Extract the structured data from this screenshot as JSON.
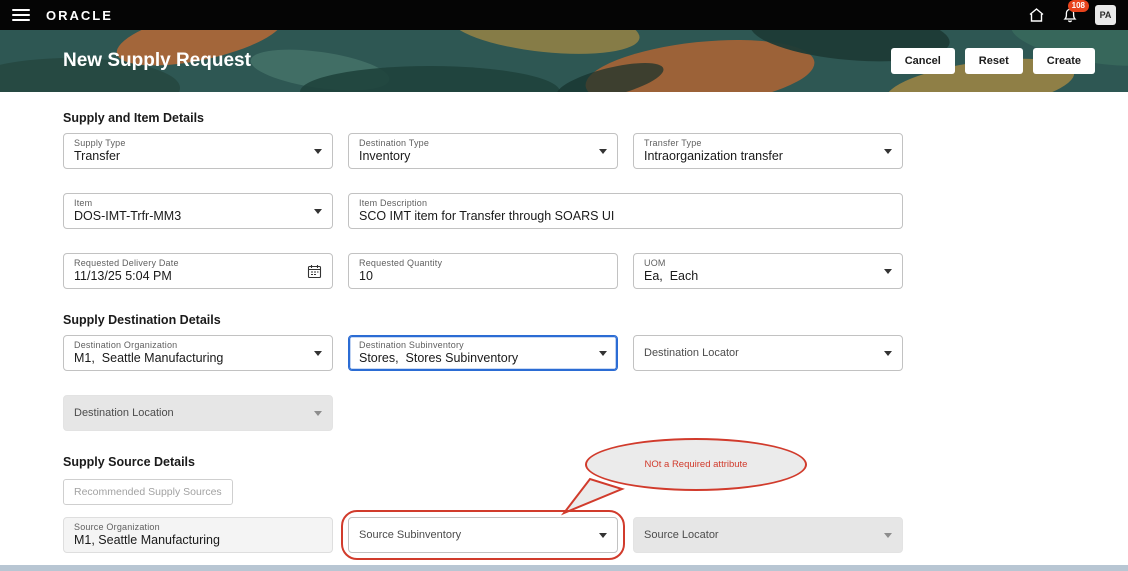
{
  "topbar": {
    "brand": "ORACLE",
    "notification_count": "108",
    "avatar_initials": "PA"
  },
  "header": {
    "title": "New Supply Request",
    "actions": {
      "cancel": "Cancel",
      "reset": "Reset",
      "create": "Create"
    }
  },
  "supply_item": {
    "heading": "Supply and Item Details",
    "supply_type": {
      "label": "Supply Type",
      "value": "Transfer"
    },
    "destination_type": {
      "label": "Destination Type",
      "value": "Inventory"
    },
    "transfer_type": {
      "label": "Transfer Type",
      "value": "Intraorganization transfer"
    },
    "item": {
      "label": "Item",
      "value": "DOS-IMT-Trfr-MM3"
    },
    "item_description": {
      "label": "Item Description",
      "value": "SCO IMT item for Transfer through SOARS UI"
    },
    "requested_delivery_date": {
      "label": "Requested Delivery Date",
      "value": "11/13/25 5:04 PM"
    },
    "requested_quantity": {
      "label": "Requested Quantity",
      "value": "10"
    },
    "uom": {
      "label": "UOM",
      "value": "Ea,  Each"
    }
  },
  "destination": {
    "heading": "Supply Destination Details",
    "destination_organization": {
      "label": "Destination Organization",
      "value": "M1,  Seattle Manufacturing"
    },
    "destination_subinventory": {
      "label": "Destination Subinventory",
      "value": "Stores,  Stores Subinventory"
    },
    "destination_locator": {
      "label": "Destination Locator"
    },
    "destination_location": {
      "label": "Destination Location"
    }
  },
  "source": {
    "heading": "Supply Source Details",
    "recommended_button": "Recommended Supply Sources",
    "source_organization": {
      "label": "Source Organization",
      "value": "M1, Seattle Manufacturing"
    },
    "source_subinventory": {
      "label": "Source Subinventory"
    },
    "source_locator": {
      "label": "Source Locator"
    }
  },
  "annotation": {
    "text": "NOt a Required attribute"
  },
  "colors": {
    "annotation_red": "#d13b2c",
    "focus_blue": "#2b6cd4",
    "badge_orange": "#e8431c",
    "banner_teal": "#2e5753"
  }
}
